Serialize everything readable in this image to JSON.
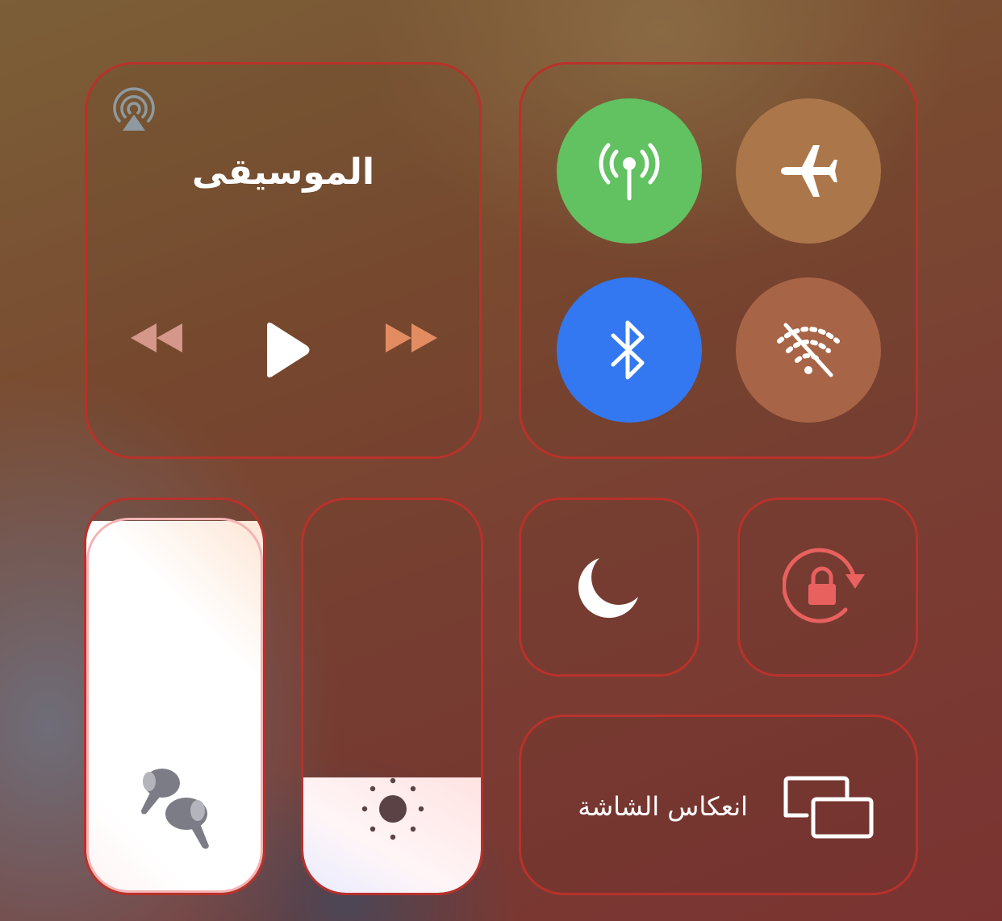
{
  "music": {
    "title": "الموسيقى",
    "airplay_icon": "airplay-icon",
    "controls": [
      "rewind-icon",
      "play-icon",
      "fast-forward-icon"
    ]
  },
  "connectivity": {
    "buttons": [
      {
        "name": "cellular-data",
        "icon": "antenna-icon",
        "color": "#62c161",
        "state": "on"
      },
      {
        "name": "airplane-mode",
        "icon": "airplane-icon",
        "color": "#ab7649",
        "state": "off"
      },
      {
        "name": "bluetooth",
        "icon": "bluetooth-icon",
        "color": "#3378f0",
        "state": "on"
      },
      {
        "name": "wifi",
        "icon": "wifi-off-icon",
        "color": "#a86446",
        "state": "off"
      }
    ]
  },
  "volume": {
    "icon": "airpods-pro-icon",
    "level_percent": 94
  },
  "brightness": {
    "icon": "sun-icon",
    "level_percent": 30
  },
  "do_not_disturb": {
    "icon": "moon-icon"
  },
  "rotation_lock": {
    "icon": "rotation-lock-icon",
    "color": "#e8615f"
  },
  "screen_mirroring": {
    "label": "انعكاس الشاشة",
    "icon": "screen-mirroring-icon"
  },
  "colors": {
    "tile_border": "#b9312b",
    "slider_border": "#f4b4b4"
  }
}
